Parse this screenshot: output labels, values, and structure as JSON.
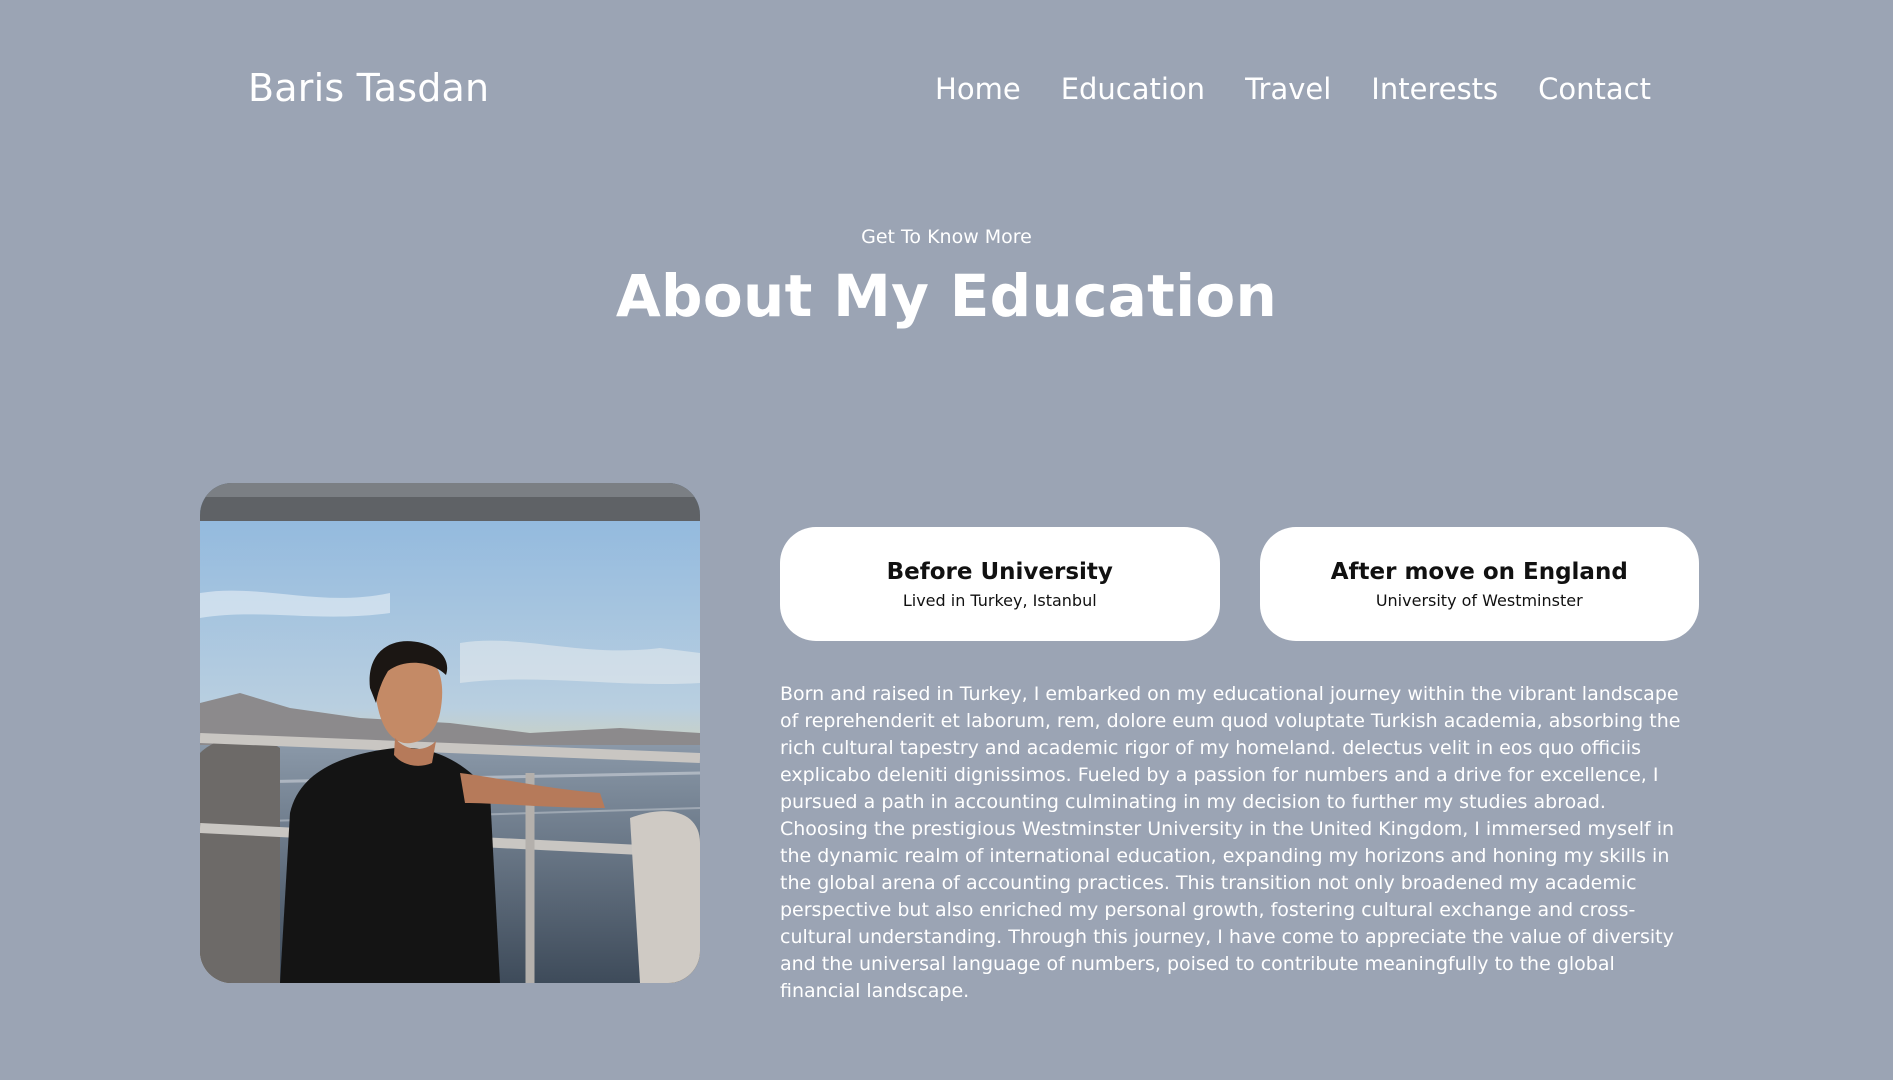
{
  "nav": {
    "logo": "Baris Tasdan",
    "links": [
      {
        "label": "Home"
      },
      {
        "label": "Education"
      },
      {
        "label": "Travel"
      },
      {
        "label": "Interests"
      },
      {
        "label": "Contact"
      }
    ]
  },
  "section": {
    "eyebrow": "Get To Know More",
    "title": "About My Education"
  },
  "photo": {
    "icon": "profile-photo-on-boat-at-sunset"
  },
  "cards": [
    {
      "title": "Before University",
      "subtitle": "Lived in Turkey, Istanbul"
    },
    {
      "title": "After move on England",
      "subtitle": "University of Westminster"
    }
  ],
  "about_text": "Born and raised in Turkey, I embarked on my educational journey within the vibrant landscape of reprehenderit et laborum, rem, dolore eum quod voluptate Turkish academia, absorbing the rich cultural tapestry and academic rigor of my homeland. delectus velit in eos quo officiis explicabo deleniti dignissimos. Fueled by a passion for numbers and a drive for excellence, I pursued a path in accounting culminating in my decision to further my studies abroad. Choosing the prestigious Westminster University in the United Kingdom, I immersed myself in the dynamic realm of international education, expanding my horizons and honing my skills in the global arena of accounting practices. This transition not only broadened my academic perspective but also enriched my personal growth, fostering cultural exchange and cross-cultural understanding. Through this journey, I have come to appreciate the value of diversity and the universal language of numbers, poised to contribute meaningfully to the global financial landscape.",
  "colors": {
    "background": "#9ba4b4",
    "card": "#ffffff",
    "text": "#ffffff"
  }
}
